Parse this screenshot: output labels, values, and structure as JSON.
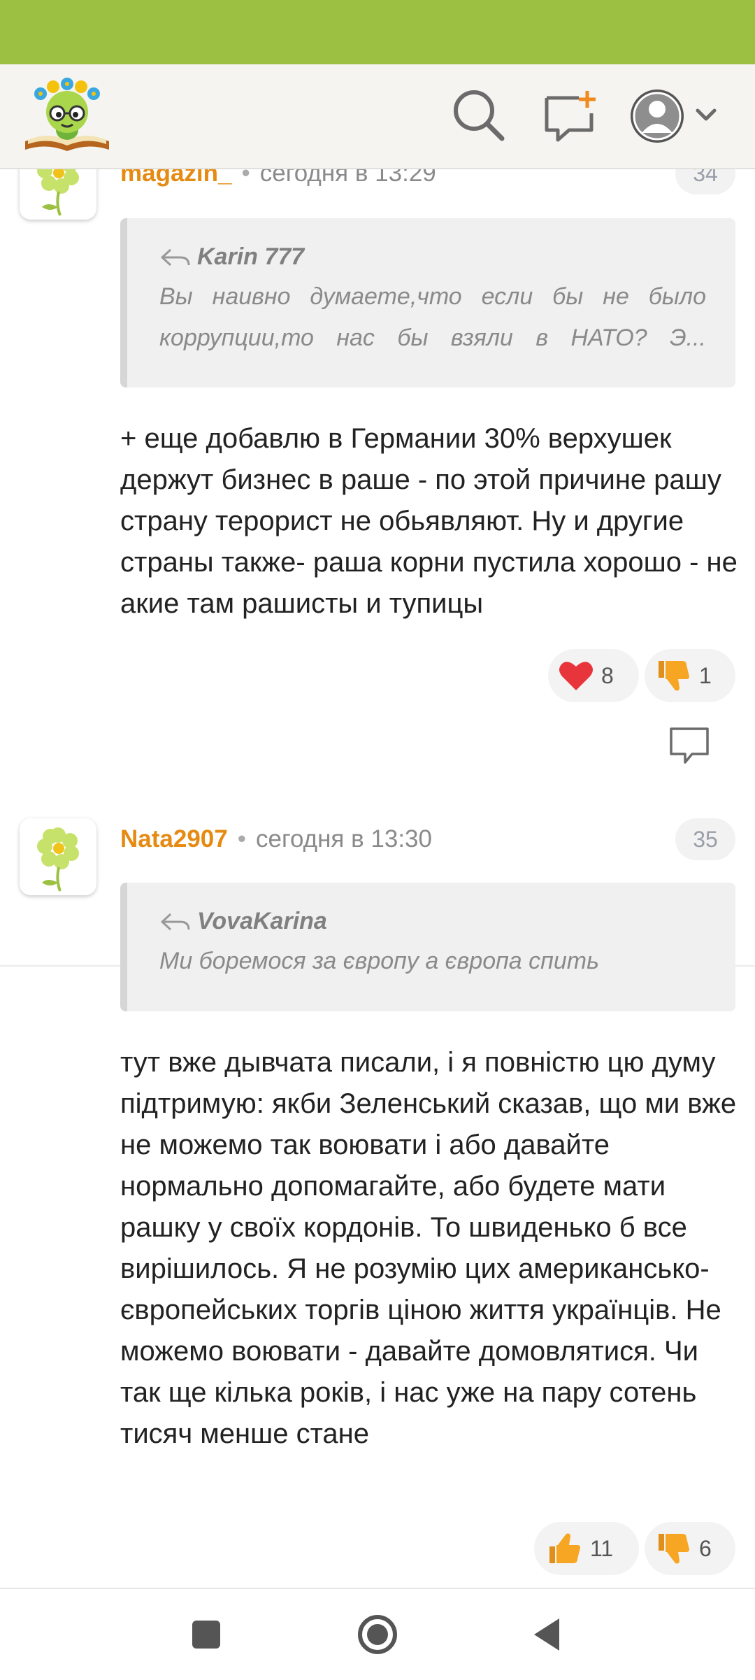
{
  "comments": [
    {
      "username": "magazin_",
      "separator": "•",
      "time": "сегодня в 13:29",
      "number": "34",
      "quote": {
        "author": "Karin 777",
        "lines": [
          "Вы наивно думаете,что если бы не было",
          "коррупции,то нас бы взяли в НАТО? Э..."
        ]
      },
      "text": "+ еще добавлю в Германии 30% верхушек держут бизнес в раше - по этой причине рашу страну терорист не обьявляют. Ну и другие страны также- раша корни пустила хорошо - не акие там рашисты и тупицы",
      "reactions": [
        {
          "icon": "heart-icon",
          "count": "8"
        },
        {
          "icon": "thumbs-down-icon",
          "count": "1"
        }
      ]
    },
    {
      "username": "Nata2907",
      "separator": "•",
      "time": "сегодня в 13:30",
      "number": "35",
      "quote": {
        "author": "VovaKarina",
        "lines": [
          "Ми боремося за європу а європа спить"
        ]
      },
      "text": "тут вже дывчата писали, і я повністю цю думу підтримую: якби Зеленський сказав, що ми вже не можемо так воювати і або давайте нормально допомагайте, або будете мати рашку у своїх кордонів. То швиденько б все вирішилось. Я не розумію цих американсько-європейських торгів ціною життя українців. Не можемо воювати - давайте домовлятися. Чи так ще кілька років, і нас уже на пару сотень тисяч менше стане",
      "reactions": [
        {
          "icon": "thumbs-up-icon",
          "count": "11"
        },
        {
          "icon": "thumbs-down-icon",
          "count": "6"
        }
      ]
    }
  ],
  "header": {
    "icons": [
      "logo-icon",
      "search-icon",
      "new-message-icon",
      "user-avatar-icon",
      "chevron-down-icon"
    ]
  },
  "nav": {
    "icons": [
      "recent-apps-icon",
      "home-icon",
      "back-icon"
    ]
  },
  "colors": {
    "status_bar": "#9cc142",
    "username": "#e58a12",
    "heart": "#e8343b",
    "thumb": "#f6a623"
  }
}
